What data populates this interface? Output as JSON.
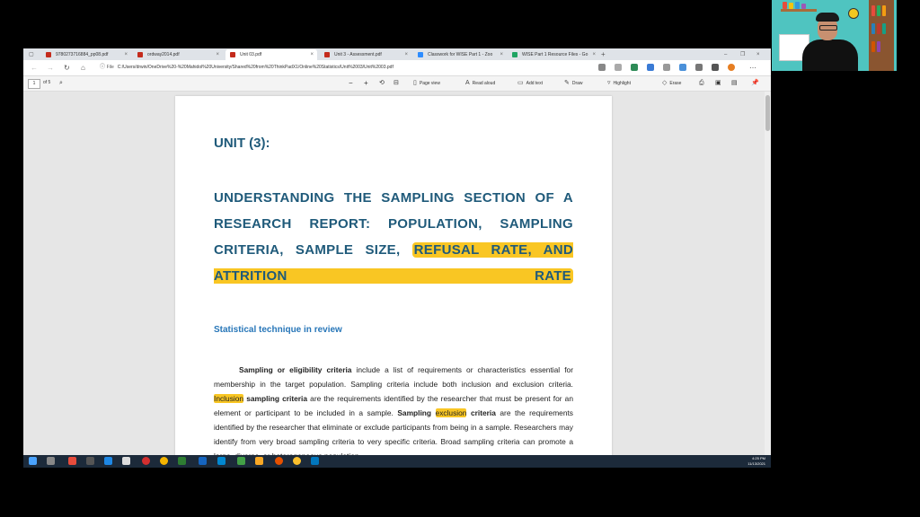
{
  "browser": {
    "tabs": [
      {
        "label": "9780273716884_pp08.pdf",
        "active": false,
        "color": "#c42b1c"
      },
      {
        "label": "ordway2014.pdf",
        "active": false,
        "color": "#c42b1c"
      },
      {
        "label": "Unit 03.pdf",
        "active": true,
        "color": "#c42b1c"
      },
      {
        "label": "Unit 3 - Assessment.pdf",
        "active": false,
        "color": "#c42b1c"
      },
      {
        "label": "Classwork for WISE Part 1 - Zoo",
        "active": false,
        "color": "#2d8cff"
      },
      {
        "label": "WISE Part 1 Resource Files - Go",
        "active": false,
        "color": "#1fa463"
      }
    ],
    "new_tab": "+",
    "address": {
      "label": "File",
      "url": "C:/Users/drwin/OneDrive%20-%20Mahidol%20University/Shared%20from%20ThinkPadX1/Online%20Statistics/Unit%2003/Unit%2003.pdf"
    }
  },
  "pdf_toolbar": {
    "page_number": "1",
    "page_of": "of 5",
    "page_view": "Page view",
    "read_aloud": "Read aloud",
    "add_text": "Add text",
    "draw": "Draw",
    "highlight": "Highlight",
    "erase": "Erase"
  },
  "document": {
    "unit_heading": "UNIT (3):",
    "title_part1": "UNDERSTANDING THE SAMPLING SECTION OF A RESEARCH REPORT: POPULATION, SAMPLING CRITERIA, SAMPLE SIZE,",
    "title_highlight": "REFUSAL RATE, AND ATTRITION RATE",
    "section_heading": "Statistical technique in review",
    "p_bold1": "Sampling or eligibility criteria",
    "p_text1": " include a list of requirements or characteristics essential for membership in the target population. Sampling criteria include both inclusion and exclusion criteria. ",
    "p_hl1": "Inclusion",
    "p_bold2": " sampling criteria",
    "p_text2": " are the requirements identified by the researcher that must be present for an element or participant to be included in a sample. ",
    "p_bold3": "Sampling ",
    "p_hl2": "exclusion",
    "p_bold4": " criteria",
    "p_text3": " are the requirements identified by the researcher that eliminate or exclude participants from being in a sample. Researchers may identify from very broad sampling criteria to very specific criteria. Broad sampling criteria can promote a large, diverse, or heterogeneous population"
  },
  "taskbar": {
    "time": "4:25 PM",
    "date": "11/13/2021"
  },
  "colors": {
    "heading": "#1f5a7a",
    "subheading": "#2776b8",
    "highlight": "#f9c623"
  }
}
